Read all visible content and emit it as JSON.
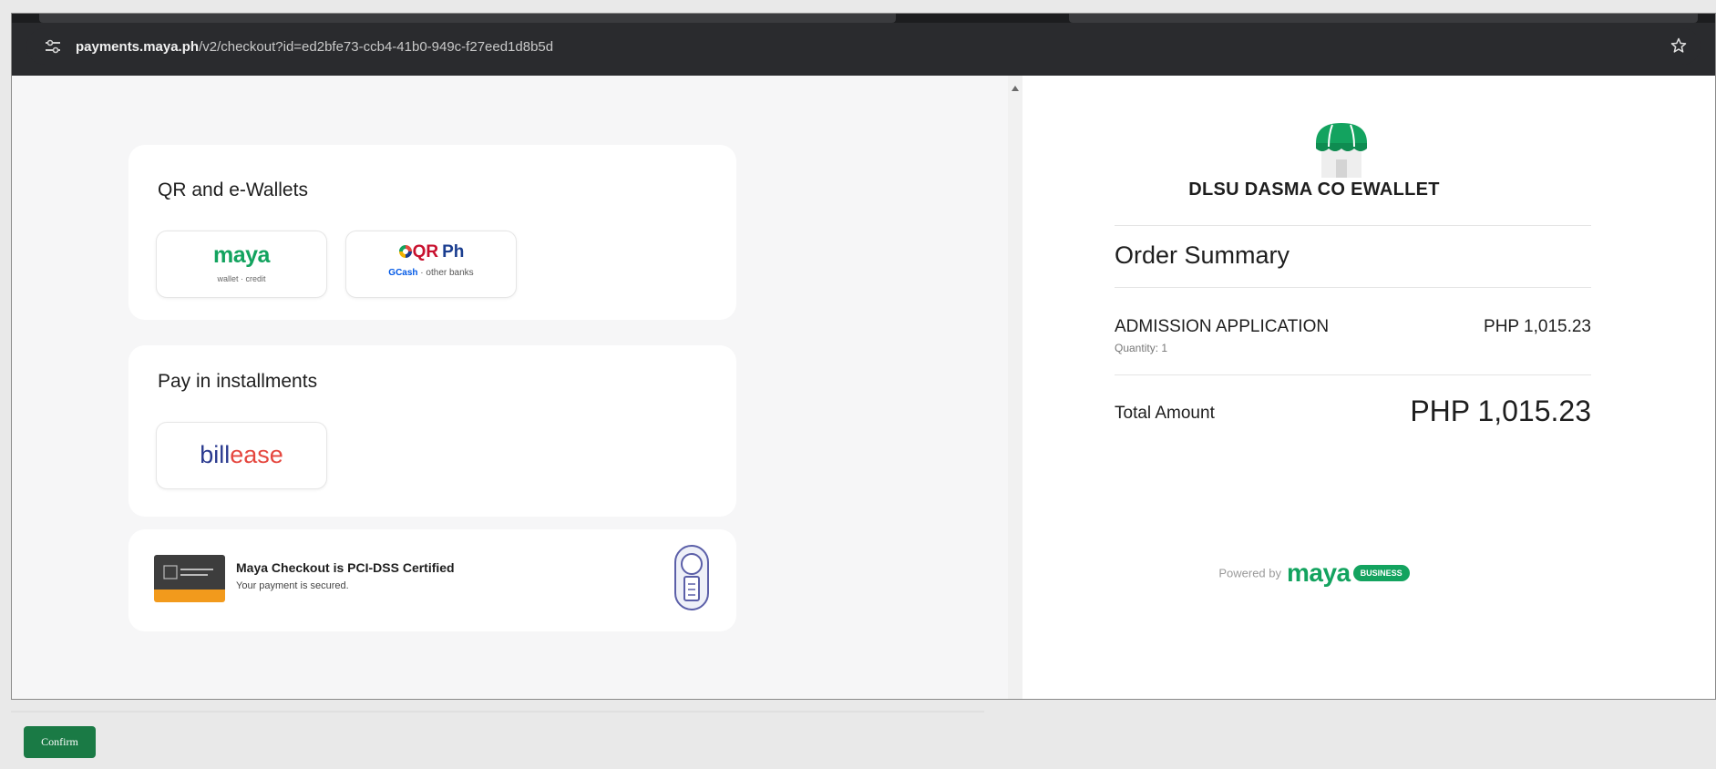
{
  "browser": {
    "url_domain": "payments.maya.ph",
    "url_path": "/v2/checkout?id=ed2bfe73-ccb4-41b0-949c-f27eed1d8b5d"
  },
  "payment_methods": {
    "qr_section": {
      "title": "QR and e-Wallets",
      "maya": {
        "logo_text": "maya",
        "subtitle": "wallet · credit"
      },
      "qrph": {
        "logo_qr": "QR",
        "logo_ph": "Ph",
        "gcash_text": "GCash",
        "subtitle": " · other banks"
      }
    },
    "installments_section": {
      "title": "Pay in installments",
      "billease": {
        "part1": "bill",
        "part2": "ease"
      }
    },
    "pci": {
      "title": "Maya Checkout is PCI-DSS Certified",
      "subtitle": "Your payment is secured."
    }
  },
  "order": {
    "merchant_name": "DLSU DASMA CO EWALLET",
    "summary_title": "Order Summary",
    "item": {
      "name": "ADMISSION APPLICATION",
      "quantity": "Quantity: 1",
      "price": "PHP 1,015.23"
    },
    "total_label": "Total Amount",
    "total_value": "PHP 1,015.23",
    "powered_by": "Powered by",
    "powered_brand": "maya",
    "powered_badge": "BUSINESS"
  },
  "footer": {
    "confirm_label": "Confirm"
  },
  "colors": {
    "maya_green": "#13a35f",
    "confirm_green": "#1a7a45",
    "browser_dark": "#2a2b2e"
  }
}
